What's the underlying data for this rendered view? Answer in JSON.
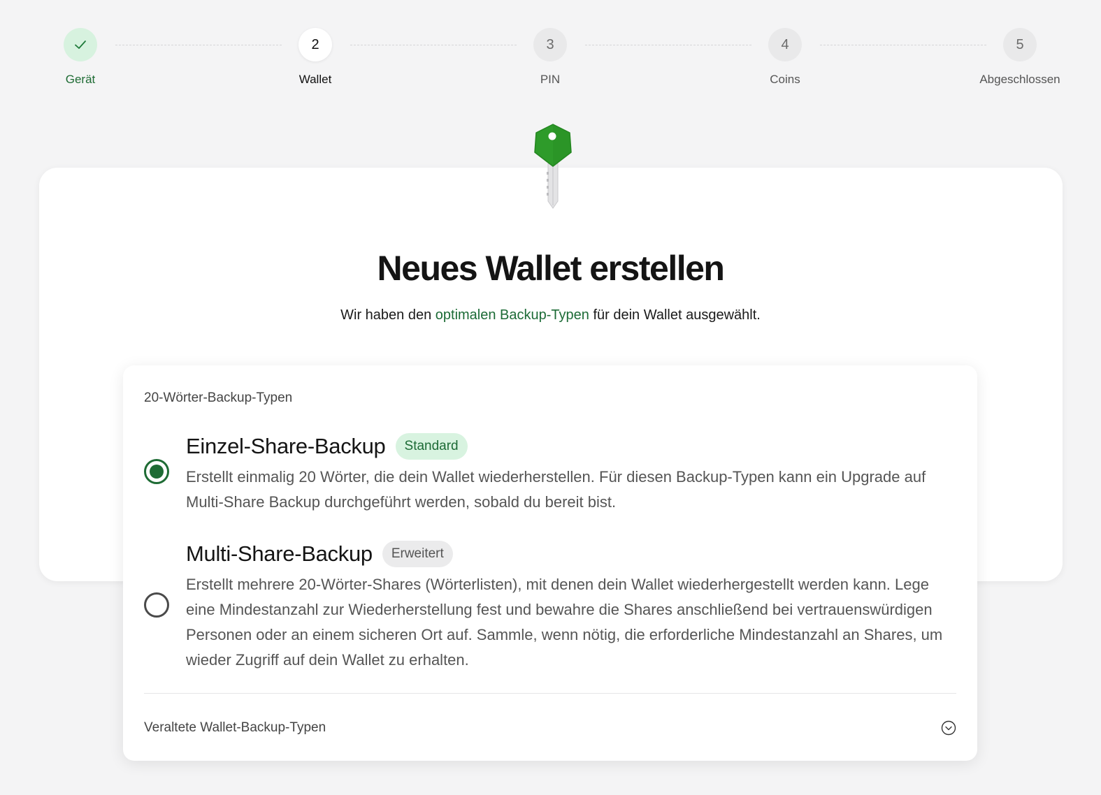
{
  "stepper": {
    "steps": [
      {
        "number": "",
        "label": "Gerät",
        "state": "done"
      },
      {
        "number": "2",
        "label": "Wallet",
        "state": "active"
      },
      {
        "number": "3",
        "label": "PIN",
        "state": "pending"
      },
      {
        "number": "4",
        "label": "Coins",
        "state": "pending"
      },
      {
        "number": "5",
        "label": "Abgeschlossen",
        "state": "pending"
      }
    ]
  },
  "header": {
    "title": "Neues Wallet erstellen",
    "subtitle_before": "Wir haben den ",
    "subtitle_link": "optimalen Backup-Typen",
    "subtitle_after": " für dein Wallet ausgewählt."
  },
  "backup": {
    "section_label": "20-Wörter-Backup-Typen",
    "options": [
      {
        "title": "Einzel-Share-Backup",
        "badge": "Standard",
        "selected": true,
        "description": "Erstellt einmalig 20 Wörter, die dein Wallet wiederherstellen. Für diesen Backup-Typen kann ein Upgrade auf Multi-Share Backup durchgeführt werden, sobald du bereit bist."
      },
      {
        "title": "Multi-Share-Backup",
        "badge": "Erweitert",
        "selected": false,
        "description": "Erstellt mehrere 20-Wörter-Shares (Wörterlisten), mit denen dein Wallet wiederhergestellt werden kann. Lege eine Mindestanzahl zur Wiederherstellung fest und bewahre die Shares anschließend bei vertrauenswürdigen Personen oder an einem sicheren Ort auf. Sammle, wenn nötig, die erforderliche Mindestanzahl an Shares, um wieder Zugriff auf dein Wallet zu erhalten."
      }
    ],
    "legacy_label": "Veraltete Wallet-Backup-Typen"
  },
  "colors": {
    "accent_green": "#1e6b34",
    "badge_green_bg": "#d8f3e0",
    "key_green": "#2e9b2a",
    "background": "#f4f4f5"
  },
  "icons": {
    "check": "check-icon",
    "key": "key-icon",
    "chevron": "chevron-down-icon"
  }
}
